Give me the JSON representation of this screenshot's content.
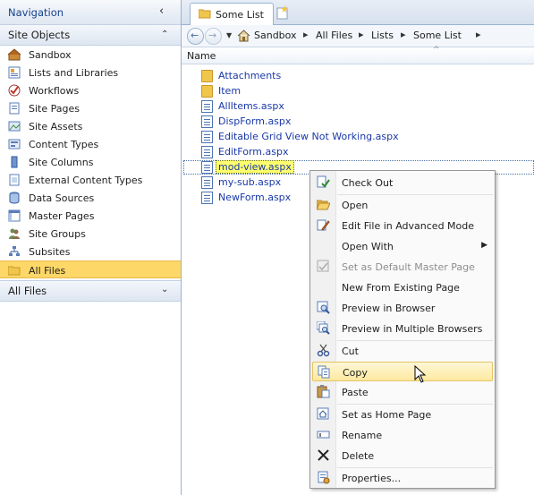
{
  "nav": {
    "header": "Navigation",
    "site_objects": {
      "title": "Site Objects",
      "items": [
        {
          "label": "Sandbox",
          "icon": "site-icon"
        },
        {
          "label": "Lists and Libraries",
          "icon": "lists-icon"
        },
        {
          "label": "Workflows",
          "icon": "workflow-icon"
        },
        {
          "label": "Site Pages",
          "icon": "site-pages-icon"
        },
        {
          "label": "Site Assets",
          "icon": "site-assets-icon"
        },
        {
          "label": "Content Types",
          "icon": "content-types-icon"
        },
        {
          "label": "Site Columns",
          "icon": "site-columns-icon"
        },
        {
          "label": "External Content Types",
          "icon": "external-content-types-icon"
        },
        {
          "label": "Data Sources",
          "icon": "data-sources-icon"
        },
        {
          "label": "Master Pages",
          "icon": "master-pages-icon"
        },
        {
          "label": "Site Groups",
          "icon": "site-groups-icon"
        },
        {
          "label": "Subsites",
          "icon": "subsites-icon"
        },
        {
          "label": "All Files",
          "icon": "folder-icon",
          "selected": true
        }
      ]
    },
    "all_files_section": "All Files"
  },
  "tab": {
    "label": "Some List"
  },
  "breadcrumb": [
    "Sandbox",
    "All Files",
    "Lists",
    "Some List"
  ],
  "column_header": "Name",
  "files": [
    {
      "name": "Attachments",
      "type": "folder"
    },
    {
      "name": "Item",
      "type": "folder"
    },
    {
      "name": "AllItems.aspx",
      "type": "page"
    },
    {
      "name": "DispForm.aspx",
      "type": "page"
    },
    {
      "name": "Editable Grid View Not Working.aspx",
      "type": "page"
    },
    {
      "name": "EditForm.aspx",
      "type": "page"
    },
    {
      "name": "mod-view.aspx",
      "type": "page",
      "selected": true
    },
    {
      "name": "my-sub.aspx",
      "type": "page"
    },
    {
      "name": "NewForm.aspx",
      "type": "page"
    }
  ],
  "context_menu": [
    {
      "label": "Check Out",
      "icon": "check-out-icon"
    },
    {
      "separator": true
    },
    {
      "label": "Open",
      "icon": "open-folder-icon"
    },
    {
      "label": "Edit File in Advanced Mode",
      "icon": "edit-advanced-icon"
    },
    {
      "label": "Open With",
      "submenu": true
    },
    {
      "label": "Set as Default Master Page",
      "icon": "master-page-icon",
      "disabled": true
    },
    {
      "label": "New From Existing Page"
    },
    {
      "label": "Preview in Browser",
      "icon": "preview-icon"
    },
    {
      "label": "Preview in Multiple Browsers",
      "icon": "preview-multi-icon"
    },
    {
      "separator": true
    },
    {
      "label": "Cut",
      "icon": "scissors-icon"
    },
    {
      "label": "Copy",
      "icon": "copy-icon",
      "hover": true
    },
    {
      "label": "Paste",
      "icon": "paste-icon"
    },
    {
      "separator": true
    },
    {
      "label": "Set as Home Page",
      "icon": "home-page-icon"
    },
    {
      "label": "Rename",
      "icon": "rename-icon"
    },
    {
      "label": "Delete",
      "icon": "delete-icon"
    },
    {
      "separator": true
    },
    {
      "label": "Properties...",
      "icon": "properties-icon"
    }
  ],
  "colors": {
    "selected_nav": "#fdd767",
    "link": "#1a39a8",
    "header_text": "#15428b",
    "menu_hover": "#fde99f"
  }
}
